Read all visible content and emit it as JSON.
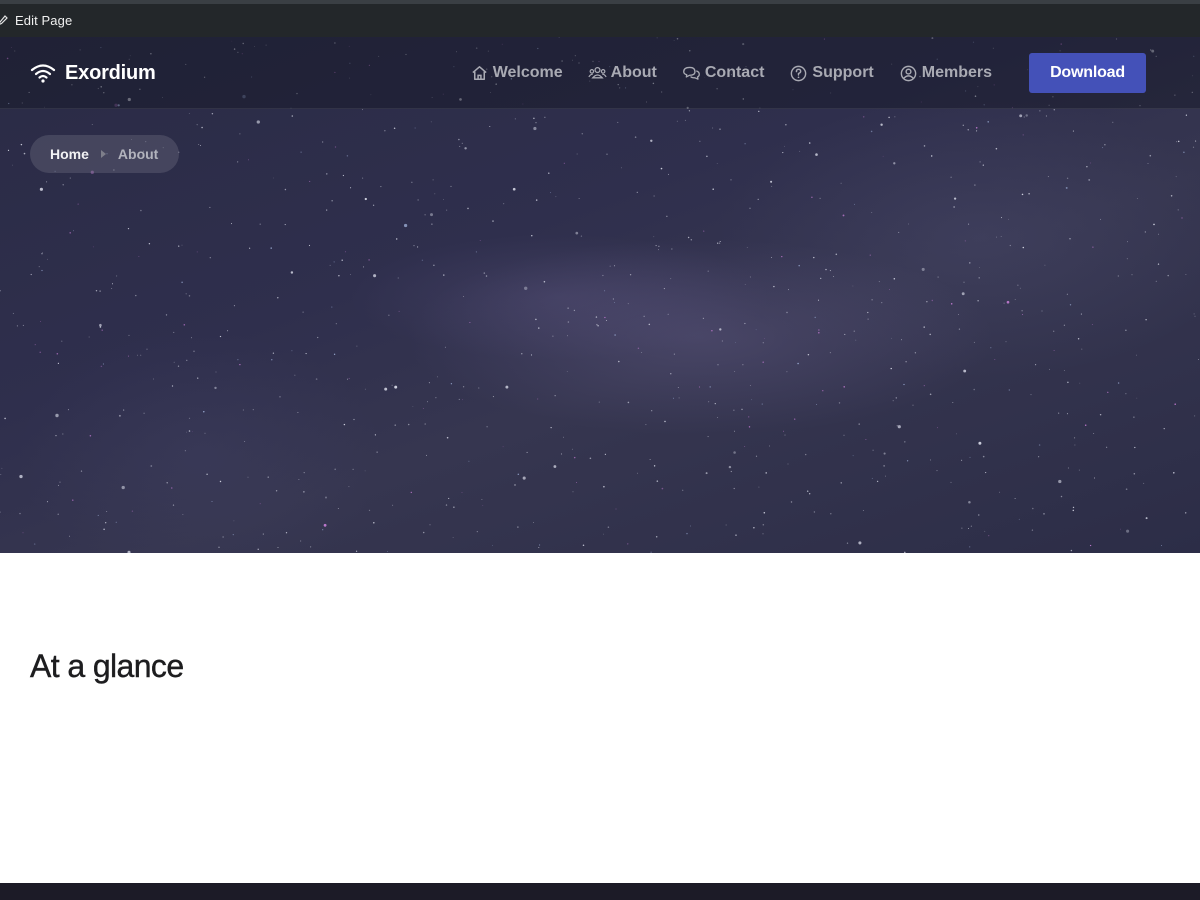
{
  "admin_bar": {
    "edit_label": "Edit Page",
    "icon": "pencil-icon"
  },
  "brand": {
    "name": "Exordium",
    "icon": "wifi-icon"
  },
  "nav": {
    "items": [
      {
        "label": "Welcome",
        "icon": "home-icon"
      },
      {
        "label": "About",
        "icon": "users-icon"
      },
      {
        "label": "Contact",
        "icon": "chat-icon"
      },
      {
        "label": "Support",
        "icon": "question-circle-icon"
      },
      {
        "label": "Members",
        "icon": "user-circle-icon"
      }
    ],
    "download_label": "Download"
  },
  "breadcrumb": {
    "home": "Home",
    "current": "About"
  },
  "content": {
    "section_title": "At a glance"
  },
  "colors": {
    "accent": "#4451b8",
    "admin_bar": "#23272a",
    "hero": "#2f2f4d",
    "footer": "#1c1b27"
  }
}
